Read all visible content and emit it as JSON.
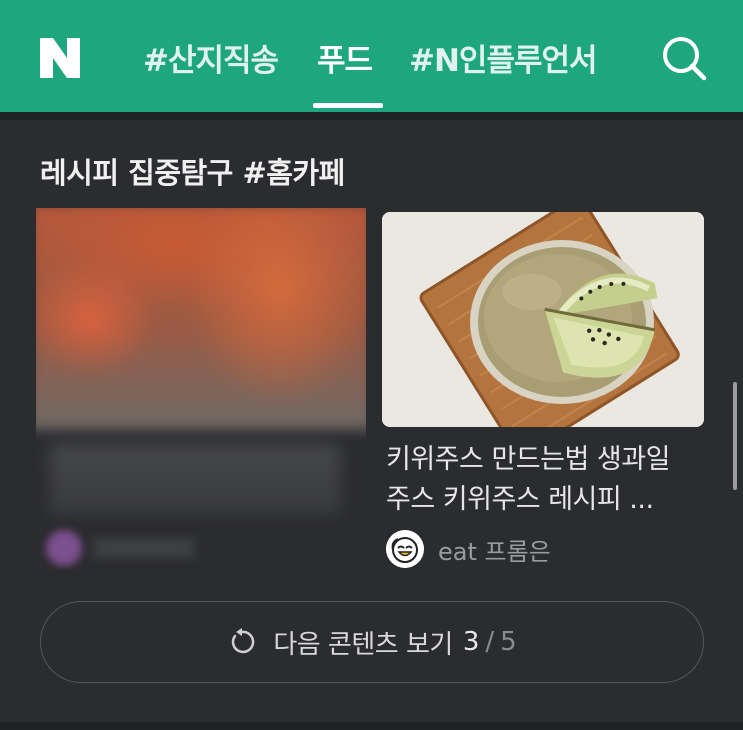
{
  "header": {
    "logo_icon": "naver-n-logo-icon",
    "tabs": [
      {
        "label": "#산지직송",
        "active": false
      },
      {
        "label": "푸드",
        "active": true
      },
      {
        "label": "#N인플루언서",
        "active": false
      }
    ],
    "search_icon": "search-icon",
    "colors": {
      "bar": "#1ea67e",
      "text": "#ffffff"
    }
  },
  "section": {
    "title": "레시피 집중탐구 #홈카페"
  },
  "cards": [
    {
      "blurred": true
    },
    {
      "title_line1": "키위주스 만드는법 생과일",
      "title_line2": "주스 키위주스 레시피 ...",
      "author": "eat 프롬은",
      "author_avatar_icon": "smiley-avatar-icon"
    }
  ],
  "more_button": {
    "label": "다음 콘텐츠 보기",
    "current": "3",
    "separator": "/",
    "total": "5",
    "icon": "refresh-icon"
  },
  "theme": {
    "background": "#2b2c30",
    "divider": "#202124"
  }
}
